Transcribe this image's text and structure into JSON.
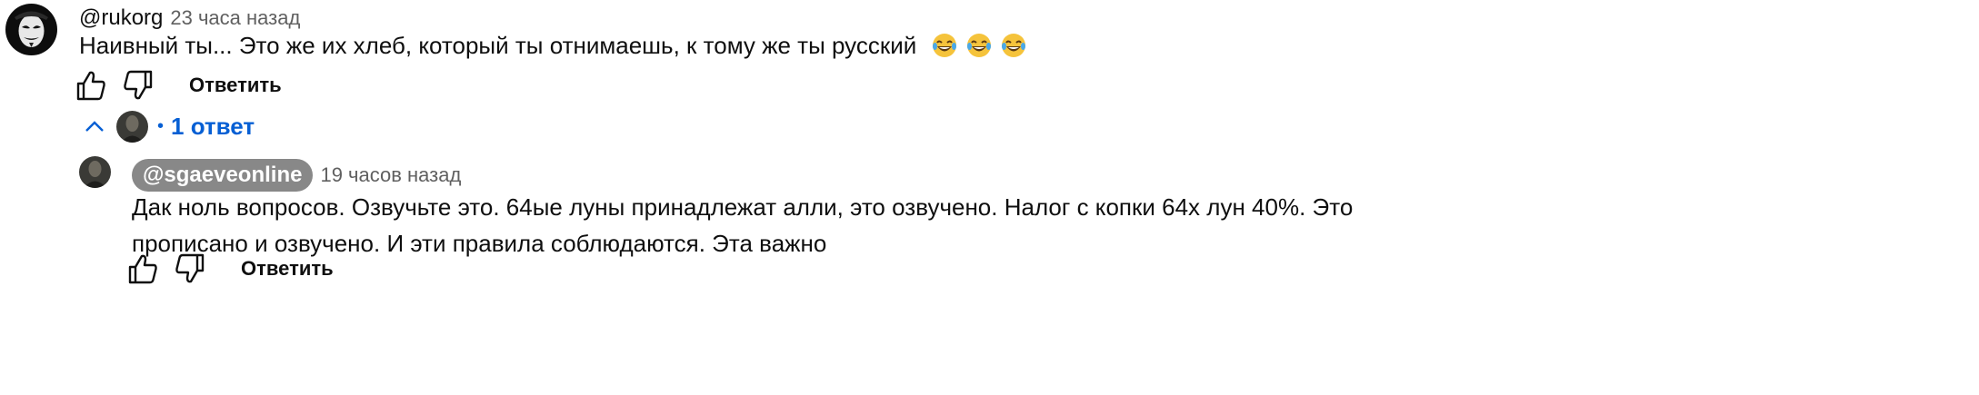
{
  "comment": {
    "author": "@rukorg",
    "time": "23 часа назад",
    "text": "Наивный ты... Это же их хлеб, который ты отнимаешь, к тому же ты русский",
    "emoji": [
      "grinning-with-tears-emoji",
      "grinning-with-tears-emoji",
      "grinning-with-tears-emoji"
    ],
    "reply_label": "Ответить"
  },
  "replies_toggle": {
    "count_label": "1 ответ",
    "bullet": "•"
  },
  "reply": {
    "author": "@sgaeveonline",
    "time": "19 часов назад",
    "text": "Дак ноль вопросов. Озвучьте это. 64ые луны принадлежат алли, это озвучено. Налог с копки 64х лун 40%. Это прописано и озвучено. И эти правила соблюдаются. Эта важно",
    "reply_label": "Ответить"
  },
  "colors": {
    "link_blue": "#065fd4",
    "secondary_text": "#606060",
    "chip_gray": "#888888"
  }
}
